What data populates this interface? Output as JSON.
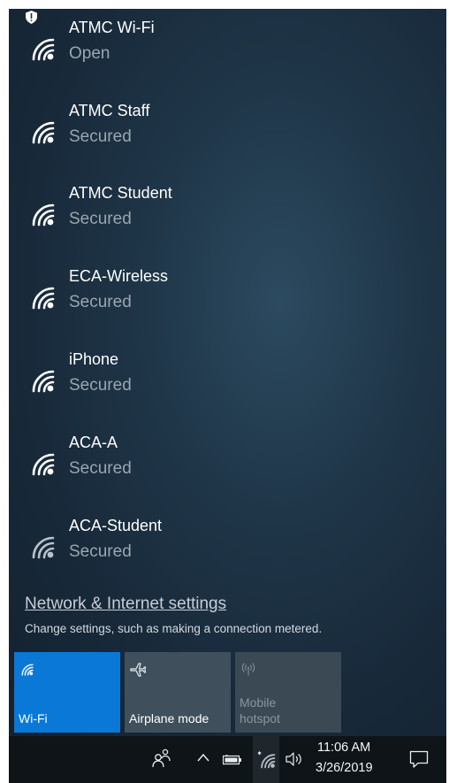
{
  "networks": [
    {
      "name": "ATMC Wi-Fi",
      "status": "Open",
      "icon": "wifi-shield-icon",
      "warning": true
    },
    {
      "name": "ATMC Staff",
      "status": "Secured",
      "icon": "wifi-icon"
    },
    {
      "name": "ATMC Student",
      "status": "Secured",
      "icon": "wifi-icon"
    },
    {
      "name": "ECA-Wireless",
      "status": "Secured",
      "icon": "wifi-icon"
    },
    {
      "name": "iPhone",
      "status": "Secured",
      "icon": "wifi-icon"
    },
    {
      "name": "ACA-A",
      "status": "Secured",
      "icon": "wifi-icon"
    },
    {
      "name": "ACA-Student",
      "status": "Secured",
      "icon": "wifi-icon"
    }
  ],
  "settings": {
    "link": "Network & Internet settings",
    "description": "Change settings, such as making a connection metered."
  },
  "quick_actions": {
    "wifi": {
      "label": "Wi-Fi",
      "active": true,
      "icon": "wifi-icon"
    },
    "airplane": {
      "label": "Airplane mode",
      "active": false,
      "icon": "airplane-icon"
    },
    "hotspot": {
      "label_line1": "Mobile",
      "label_line2": "hotspot",
      "active": false,
      "enabled": false,
      "icon": "hotspot-icon"
    }
  },
  "taskbar": {
    "icons": [
      "people-icon",
      "chevron-up-icon",
      "battery-icon",
      "wifi-icon",
      "volume-icon",
      "notification-icon"
    ],
    "time": "11:06 AM",
    "date": "3/26/2019"
  },
  "colors": {
    "accent": "#0a78d7",
    "flyout_bg": "#1c3244",
    "taskbar_bg": "#0e1418",
    "tile_bg": "#3f505c",
    "secondary_text": "#9aa6b0"
  }
}
